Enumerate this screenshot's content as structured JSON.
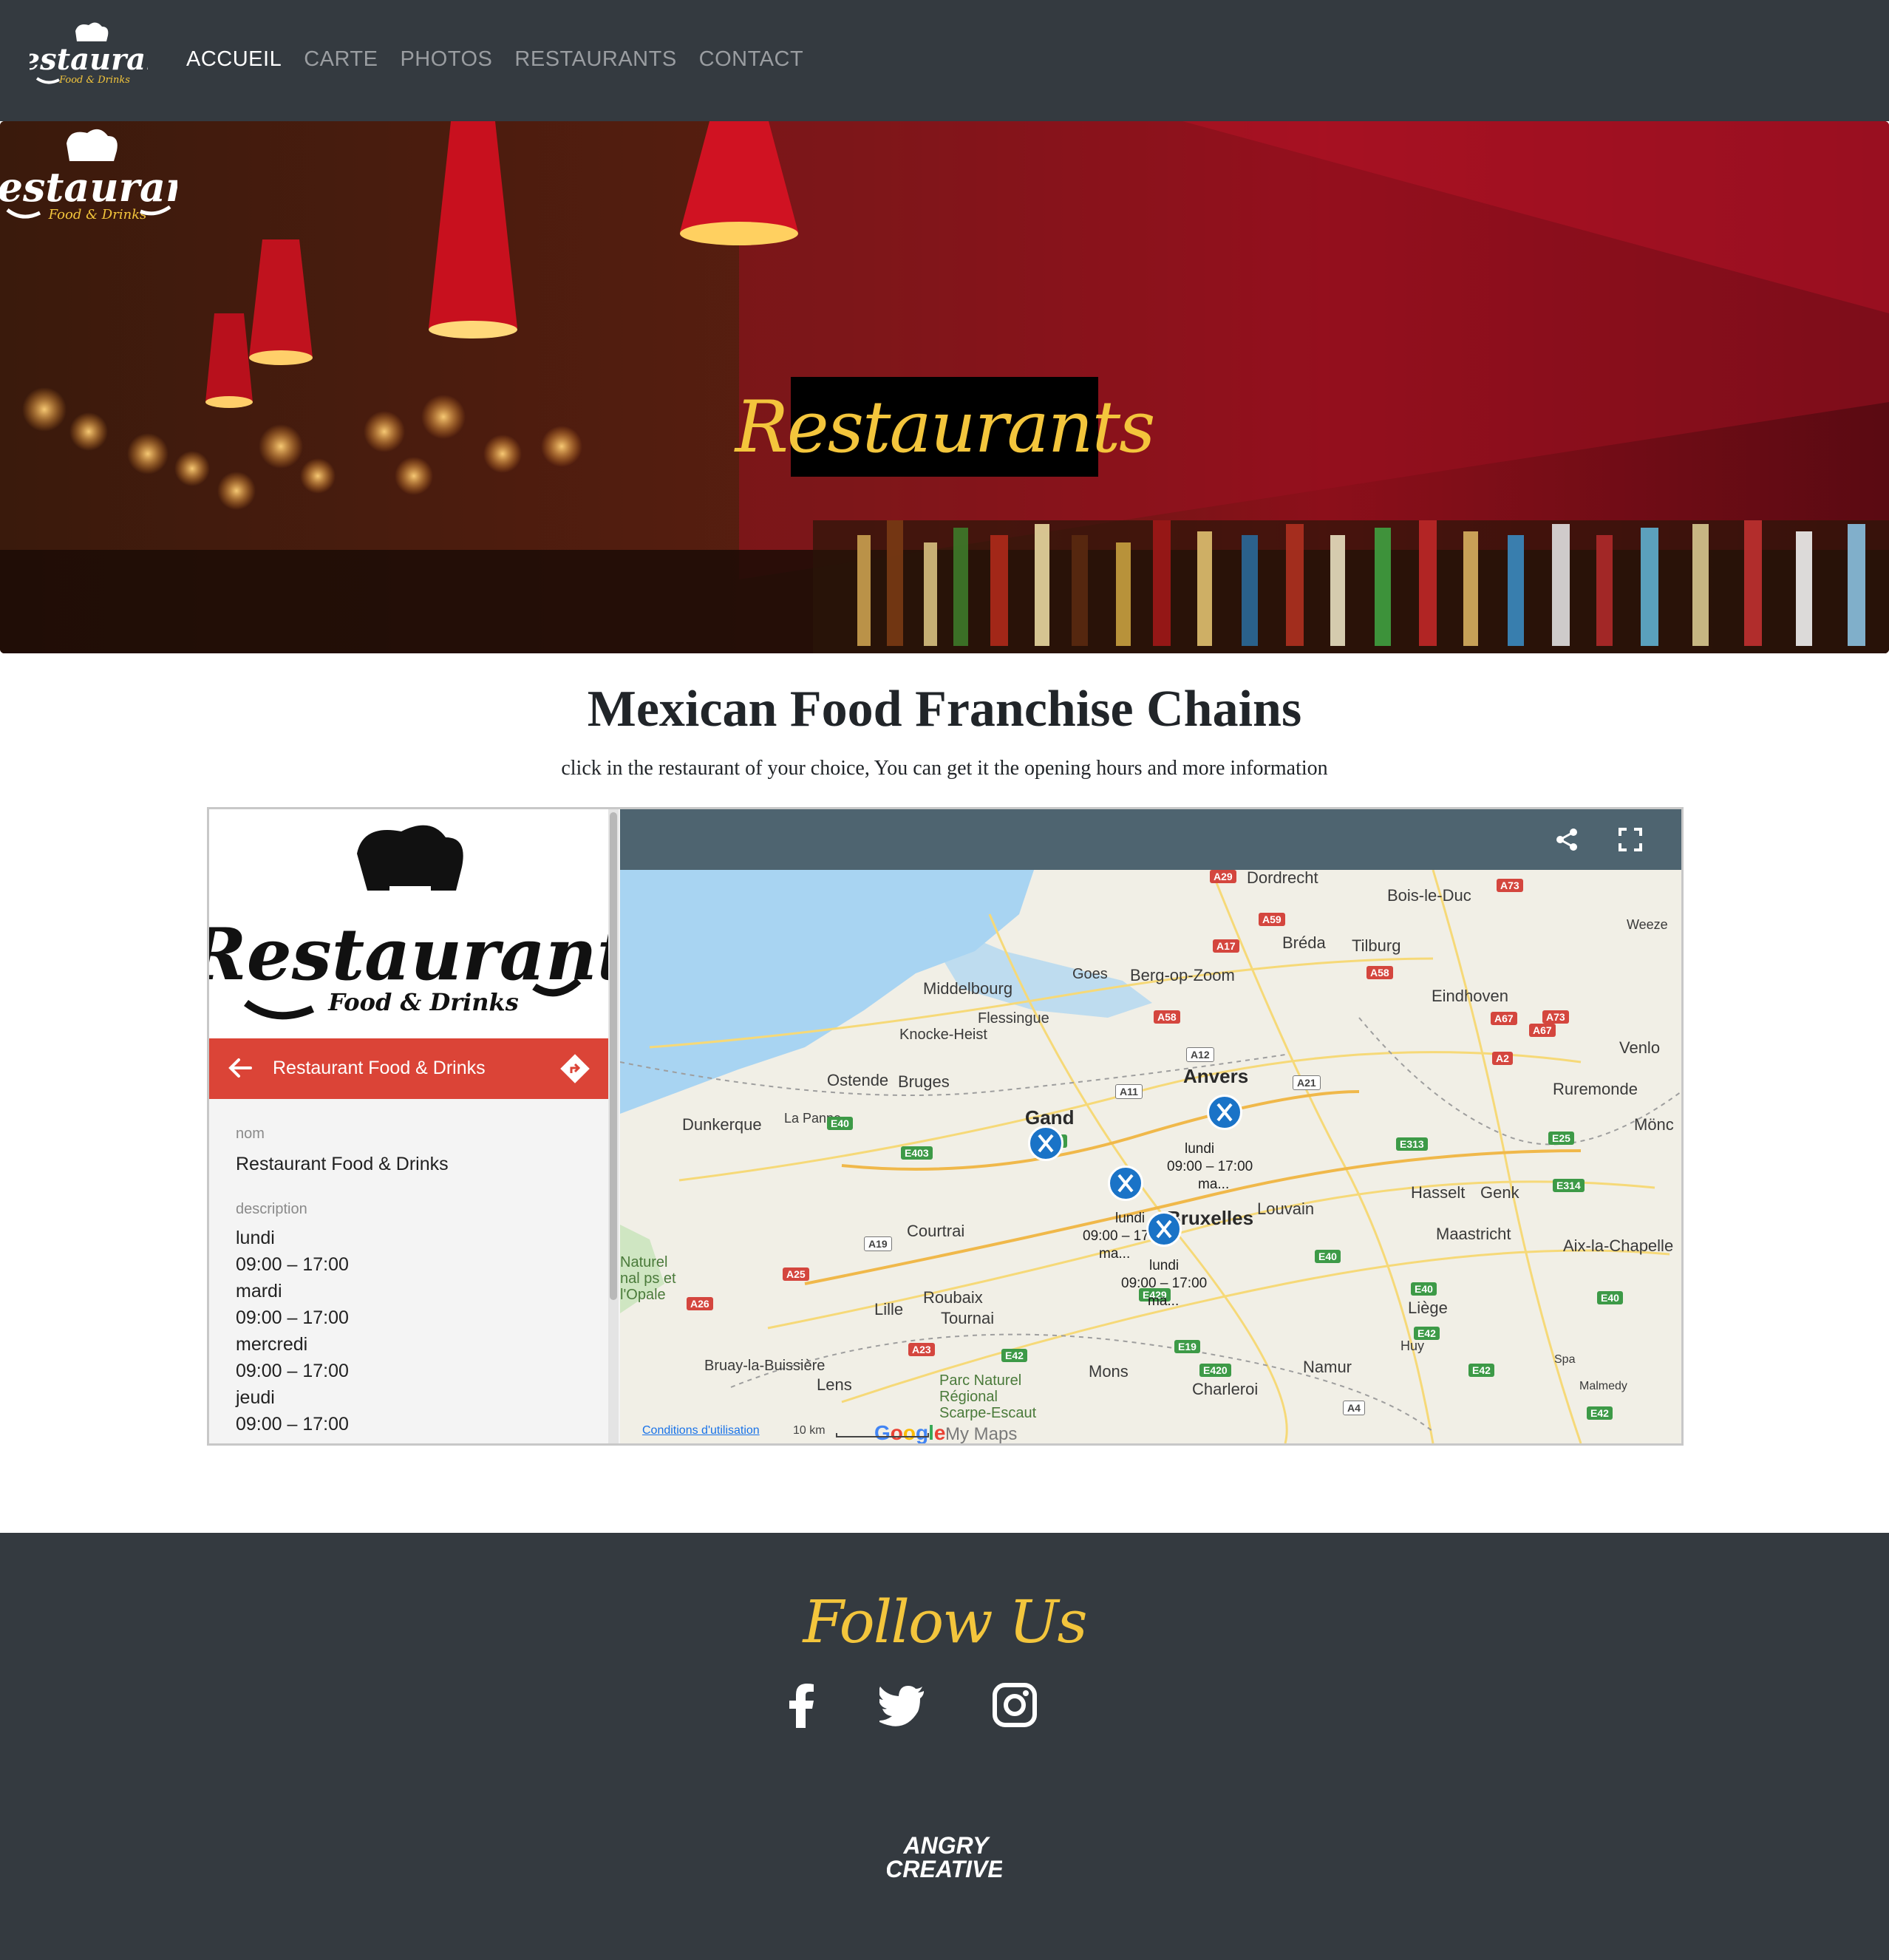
{
  "nav": {
    "brand_logo": {
      "word": "Restaurant",
      "tagline": "Food & Drinks"
    },
    "links": [
      "ACCUEIL",
      "CARTE",
      "PHOTOS",
      "RESTAURANTS",
      "CONTACT"
    ],
    "active": "ACCUEIL"
  },
  "hero": {
    "logo": {
      "word": "Restaurant",
      "tagline": "Food & Drinks"
    },
    "title": "Restaurants"
  },
  "section": {
    "title": "Mexican Food Franchise Chains",
    "subtitle": "click in the restaurant of your choice, You can get it the opening hours and more information"
  },
  "embed": {
    "side_logo": {
      "word": "Restaurant",
      "tagline": "Food & Drinks"
    },
    "header_title": "Restaurant Food & Drinks",
    "fields": {
      "name_label": "nom",
      "name_value": "Restaurant Food & Drinks",
      "desc_label": "description",
      "desc_lines": [
        "lundi",
        "09:00 – 17:00",
        "mardi",
        "09:00 – 17:00",
        "mercredi",
        "09:00 – 17:00",
        "jeudi",
        "09:00 – 17:00"
      ]
    },
    "map": {
      "cities": [
        "Dordrecht",
        "Bois-le-Duc",
        "Weeze",
        "Bréda",
        "Tilburg",
        "Goes",
        "Berg-op-Zoom",
        "Middelbourg",
        "Flessingue",
        "Eindhoven",
        "Knocke-Heist",
        "Venlo",
        "Ostende",
        "Bruges",
        "Anvers",
        "Ruremonde",
        "Dunkerque",
        "La Panne",
        "Gand",
        "Mönc",
        "Hasselt",
        "Genk",
        "Louvain",
        "Bruxelles",
        "Courtrai",
        "Maastricht",
        "Aix-la-Chapelle",
        "Lille",
        "Roubaix",
        "Tournai",
        "Liège",
        "Huy",
        "Bruay-la-Buissière",
        "Lens",
        "Mons",
        "Namur",
        "Charleroi",
        "Spa",
        "Malmedy",
        "Parc Naturel Régional Scarpe-Escaut",
        "Naturel nal ps et l'Opale"
      ],
      "roads": [
        "A29",
        "A59",
        "A73",
        "A17",
        "A58",
        "A58",
        "A67",
        "A73",
        "A67",
        "A12",
        "A2",
        "A11",
        "A21",
        "E40",
        "E17",
        "E313",
        "E25",
        "E403",
        "E314",
        "A19",
        "E40",
        "A25",
        "E40",
        "E429",
        "A26",
        "E42",
        "E19",
        "A23",
        "E42",
        "E420",
        "E42",
        "A4",
        "E42",
        "E40"
      ],
      "pins": [
        {
          "day": "lundi",
          "hours": "09:00 – 17:00",
          "next": "ma..."
        },
        {
          "day": "lundi",
          "hours": "09:00 – 17:00",
          "next": "ma..."
        },
        {
          "day": "lundi",
          "hours": "09:00 – 17:00",
          "next": "ma..."
        }
      ],
      "footer": {
        "terms": "Conditions d'utilisation",
        "scale": "10 km",
        "my_maps": "My Maps"
      }
    }
  },
  "footer": {
    "follow": "Follow Us",
    "social": [
      "facebook-icon",
      "twitter-icon",
      "instagram-icon"
    ],
    "credit_logo": [
      "ANGRY",
      "CREATIVE"
    ]
  },
  "colors": {
    "dark": "#343a40",
    "accent": "#f3c53c",
    "map_header": "#4e6470",
    "side_bar": "#db4437",
    "pin": "#1a73c7"
  }
}
